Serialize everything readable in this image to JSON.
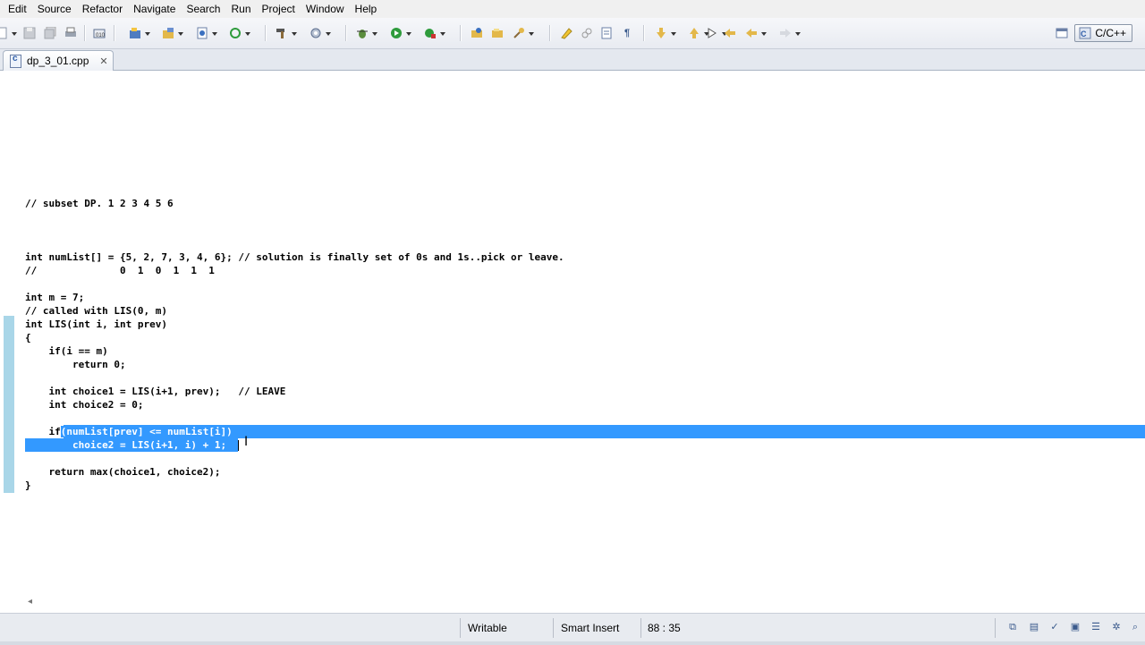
{
  "menu": [
    "Edit",
    "Source",
    "Refactor",
    "Navigate",
    "Search",
    "Run",
    "Project",
    "Window",
    "Help"
  ],
  "toolbar_icons": [
    "new-icon",
    "save-icon",
    "save-all-icon",
    "print-icon",
    "build-icon",
    "new-project-icon",
    "new-file-icon",
    "new-class-icon",
    "refresh-icon",
    "build-hammer-icon",
    "settings-icon",
    "debug-icon",
    "run-icon",
    "run-external-icon",
    "open-folder-icon",
    "open-file-icon",
    "search-icon",
    "highlight-icon",
    "link-icon",
    "annotations-icon",
    "paragraph-icon",
    "next-annotation-icon",
    "prev-annotation-icon",
    "last-edit-icon",
    "back-icon",
    "forward-icon"
  ],
  "perspective": {
    "label": "C/C++"
  },
  "tab": {
    "label": "dp_3_01.cpp",
    "close": "✕"
  },
  "code_lines": [
    {
      "text": "// subset DP. 1 2 3 4 5 6"
    },
    {
      "text": "int numList[] = {5, 2, 7, 3, 4, 6}; // solution is finally set of 0s and 1s..pick or leave."
    },
    {
      "text": "//              0  1  0  1  1  1"
    },
    {
      "text": "int m = 7;"
    },
    {
      "text": "// called with LIS(0, m)"
    },
    {
      "text": "int LIS(int i, int prev)"
    },
    {
      "text": "{"
    },
    {
      "text": "    if(i == m)"
    },
    {
      "text": "        return 0;"
    },
    {
      "text": "    int choice1 = LIS(i+1, prev);   // LEAVE"
    },
    {
      "text": "    int choice2 = 0;"
    },
    {
      "text": "    if",
      "selected": "(numList[prev] <= numList[i])"
    },
    {
      "selected": "        choice2 = LIS(i+1, i) + 1;"
    },
    {
      "text": "    return max(choice1, choice2);"
    },
    {
      "text": "}"
    }
  ],
  "status": {
    "writable": "Writable",
    "insert_mode": "Smart Insert",
    "position": "88 : 35"
  },
  "colors": {
    "selection": "#3399ff",
    "change_marker": "#a9d6e8"
  }
}
